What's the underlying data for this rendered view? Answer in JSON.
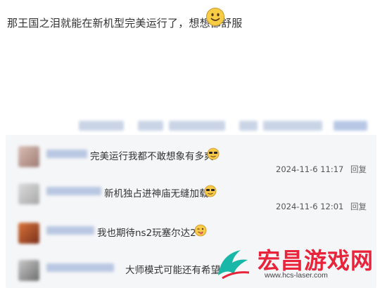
{
  "post": {
    "text": "那王国之泪就能在新机型完美运行了，想想都舒服",
    "emoji": "smile-emoji"
  },
  "replies": [
    {
      "text": "完美运行我都不敢想象有多爽",
      "emoji": "sunglasses-emoji",
      "timestamp": "2024-11-6 11:17",
      "reply_label": "回复"
    },
    {
      "text": "新机独占进神庙无缝加载",
      "emoji": "sunglasses-emoji",
      "timestamp": "2024-11-6 12:01",
      "reply_label": "回复"
    },
    {
      "text": "我也期待ns2玩塞尔达2",
      "emoji": "wink-tongue-emoji",
      "timestamp": "",
      "reply_label": ""
    },
    {
      "text": "大师模式可能还有希望",
      "emoji": "",
      "timestamp": "",
      "reply_label": ""
    }
  ],
  "watermark": {
    "title": "宏昌游戏网",
    "url": "www.hcs-laser.com"
  },
  "colors": {
    "panel_bg": "#f5f6f8",
    "watermark_red": "#e8233a",
    "watermark_teal": "#19b7a8"
  }
}
